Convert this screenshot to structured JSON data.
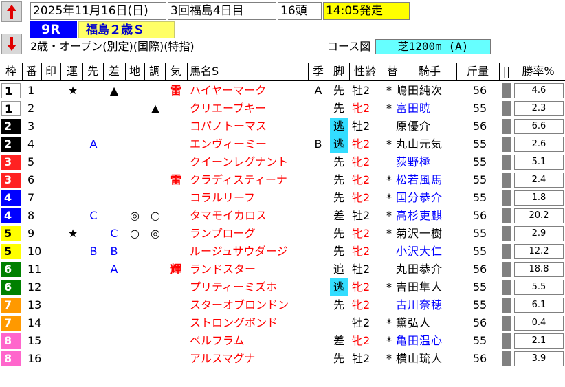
{
  "header": {
    "date": "2025年11月16日(日)",
    "meeting": "3回福島4日目",
    "field_size": "16頭",
    "post_time": "14:05発走",
    "race_number": "9R",
    "race_name": "福島２歳Ｓ",
    "conditions": "2歳・オープン(別定)(国際)(特指)",
    "course_link": "コース図",
    "surface": "芝1200m (A)",
    "colors": {
      "post_time_bg": "#ffff00",
      "race_number_bg": "#0000ff",
      "race_name_bg": "#ffff66",
      "surface_bg": "#66ffff"
    }
  },
  "columns": [
    "枠",
    "番",
    "印",
    "運",
    "先",
    "差",
    "地",
    "調",
    "気",
    "馬名S",
    "季",
    "脚",
    "性齢",
    "替",
    "騎手",
    "斤量",
    "||",
    "勝率%"
  ],
  "waku_colors": {
    "1": {
      "bg": "#ffffff",
      "fg": "#000000"
    },
    "2": {
      "bg": "#000000",
      "fg": "#ffffff"
    },
    "3": {
      "bg": "#ff2222",
      "fg": "#ffffff"
    },
    "4": {
      "bg": "#0000ff",
      "fg": "#ffffff"
    },
    "5": {
      "bg": "#ffff00",
      "fg": "#000000"
    },
    "6": {
      "bg": "#008000",
      "fg": "#ffffff"
    },
    "7": {
      "bg": "#ff9900",
      "fg": "#ffffff"
    },
    "8": {
      "bg": "#ff66cc",
      "fg": "#ffffff"
    }
  },
  "rows": [
    {
      "waku": "1",
      "num": "1",
      "marks": [
        "★",
        "",
        "▲",
        "",
        ""
      ],
      "ki_mark": "雷",
      "horse": "ハイヤーマーク",
      "season": "A",
      "style": "先",
      "style_nige": false,
      "sex_age": "牡2",
      "sex_red": false,
      "change": "*",
      "jockey": "嶋田純次",
      "jockey_blue": false,
      "weight": "56",
      "win": "4.6"
    },
    {
      "waku": "1",
      "num": "2",
      "marks": [
        "",
        "",
        "",
        "",
        "▲"
      ],
      "ki_mark": "",
      "horse": "クリエーブキー",
      "season": "",
      "style": "先",
      "style_nige": false,
      "sex_age": "牝2",
      "sex_red": true,
      "change": "*",
      "jockey": "富田暁",
      "jockey_blue": true,
      "weight": "55",
      "win": "2.3"
    },
    {
      "waku": "2",
      "num": "3",
      "marks": [
        "",
        "",
        "",
        "",
        ""
      ],
      "ki_mark": "",
      "horse": "コパノトーマス",
      "season": "",
      "style": "逃",
      "style_nige": true,
      "sex_age": "牡2",
      "sex_red": false,
      "change": "",
      "jockey": "原優介",
      "jockey_blue": false,
      "weight": "56",
      "win": "6.6"
    },
    {
      "waku": "2",
      "num": "4",
      "marks": [
        "",
        "A",
        "",
        "",
        ""
      ],
      "ki_mark": "",
      "horse": "エンヴィーミー",
      "season": "B",
      "style": "逃",
      "style_nige": true,
      "sex_age": "牝2",
      "sex_red": true,
      "change": "*",
      "jockey": "丸山元気",
      "jockey_blue": false,
      "weight": "55",
      "win": "2.6"
    },
    {
      "waku": "3",
      "num": "5",
      "marks": [
        "",
        "",
        "",
        "",
        ""
      ],
      "ki_mark": "",
      "horse": "クイーンレグナント",
      "season": "",
      "style": "先",
      "style_nige": false,
      "sex_age": "牝2",
      "sex_red": true,
      "change": "",
      "jockey": "荻野極",
      "jockey_blue": true,
      "weight": "55",
      "win": "5.1"
    },
    {
      "waku": "3",
      "num": "6",
      "marks": [
        "",
        "",
        "",
        "",
        ""
      ],
      "ki_mark": "雷",
      "horse": "クラディスティーナ",
      "season": "",
      "style": "先",
      "style_nige": false,
      "sex_age": "牝2",
      "sex_red": true,
      "change": "*",
      "jockey": "松若風馬",
      "jockey_blue": true,
      "weight": "55",
      "win": "2.4"
    },
    {
      "waku": "4",
      "num": "7",
      "marks": [
        "",
        "",
        "",
        "",
        ""
      ],
      "ki_mark": "",
      "horse": "コラルリーフ",
      "season": "",
      "style": "先",
      "style_nige": false,
      "sex_age": "牝2",
      "sex_red": true,
      "change": "*",
      "jockey": "国分恭介",
      "jockey_blue": true,
      "weight": "55",
      "win": "1.8"
    },
    {
      "waku": "4",
      "num": "8",
      "marks": [
        "",
        "C",
        "",
        "◎",
        "○"
      ],
      "ki_mark": "",
      "horse": "タマモイカロス",
      "season": "",
      "style": "差",
      "style_nige": false,
      "sex_age": "牡2",
      "sex_red": false,
      "change": "*",
      "jockey": "高杉吏麒",
      "jockey_blue": true,
      "weight": "56",
      "win": "20.2"
    },
    {
      "waku": "5",
      "num": "9",
      "marks": [
        "★",
        "",
        "C",
        "○",
        "◎"
      ],
      "ki_mark": "",
      "horse": "ランプローグ",
      "season": "",
      "style": "先",
      "style_nige": false,
      "sex_age": "牝2",
      "sex_red": true,
      "change": "*",
      "jockey": "菊沢一樹",
      "jockey_blue": false,
      "weight": "55",
      "win": "2.9"
    },
    {
      "waku": "5",
      "num": "10",
      "marks": [
        "",
        "B",
        "B",
        "",
        ""
      ],
      "ki_mark": "",
      "horse": "ルージュサウダージ",
      "season": "",
      "style": "先",
      "style_nige": false,
      "sex_age": "牝2",
      "sex_red": true,
      "change": "",
      "jockey": "小沢大仁",
      "jockey_blue": true,
      "weight": "55",
      "win": "12.2"
    },
    {
      "waku": "6",
      "num": "11",
      "marks": [
        "",
        "",
        "A",
        "",
        ""
      ],
      "ki_mark": "輝",
      "horse": "ランドスター",
      "season": "",
      "style": "追",
      "style_nige": false,
      "sex_age": "牡2",
      "sex_red": false,
      "change": "",
      "jockey": "丸田恭介",
      "jockey_blue": false,
      "weight": "56",
      "win": "18.8"
    },
    {
      "waku": "6",
      "num": "12",
      "marks": [
        "",
        "",
        "",
        "",
        ""
      ],
      "ki_mark": "",
      "horse": "プリティーミズホ",
      "season": "",
      "style": "逃",
      "style_nige": true,
      "sex_age": "牝2",
      "sex_red": true,
      "change": "*",
      "jockey": "吉田隼人",
      "jockey_blue": false,
      "weight": "55",
      "win": "5.5"
    },
    {
      "waku": "7",
      "num": "13",
      "marks": [
        "",
        "",
        "",
        "",
        ""
      ],
      "ki_mark": "",
      "horse": "スターオブロンドン",
      "season": "",
      "style": "先",
      "style_nige": false,
      "sex_age": "牝2",
      "sex_red": true,
      "change": "",
      "jockey": "古川奈穂",
      "jockey_blue": true,
      "weight": "55",
      "win": "6.1"
    },
    {
      "waku": "7",
      "num": "14",
      "marks": [
        "",
        "",
        "",
        "",
        ""
      ],
      "ki_mark": "",
      "horse": "ストロングボンド",
      "season": "",
      "style": "",
      "style_nige": false,
      "sex_age": "牡2",
      "sex_red": false,
      "change": "*",
      "jockey": "黛弘人",
      "jockey_blue": false,
      "weight": "56",
      "win": "0.4"
    },
    {
      "waku": "8",
      "num": "15",
      "marks": [
        "",
        "",
        "",
        "",
        ""
      ],
      "ki_mark": "",
      "horse": "ベルフラム",
      "season": "",
      "style": "差",
      "style_nige": false,
      "sex_age": "牝2",
      "sex_red": true,
      "change": "*",
      "jockey": "亀田温心",
      "jockey_blue": true,
      "weight": "55",
      "win": "2.1"
    },
    {
      "waku": "8",
      "num": "16",
      "marks": [
        "",
        "",
        "",
        "",
        ""
      ],
      "ki_mark": "",
      "horse": "アルスマグナ",
      "season": "",
      "style": "先",
      "style_nige": false,
      "sex_age": "牡2",
      "sex_red": false,
      "change": "*",
      "jockey": "横山琉人",
      "jockey_blue": false,
      "weight": "56",
      "win": "3.9"
    }
  ]
}
